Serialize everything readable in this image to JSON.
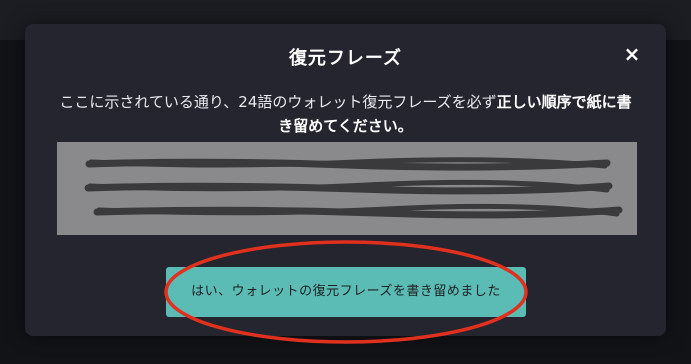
{
  "modal": {
    "title": "復元フレーズ",
    "close_label": "×",
    "instruction_plain": "ここに示されている通り、24語のウォレット復元フレーズを必ず",
    "instruction_bold": "正しい順序で紙に書き留めてください。",
    "confirm_label": "はい、ウォレットの復元フレーズを書き留めました"
  },
  "colors": {
    "accent": "#5bbcb5",
    "highlight": "#e0301e",
    "modal_bg": "#25252f",
    "redaction_box": "#8a8a8d"
  }
}
